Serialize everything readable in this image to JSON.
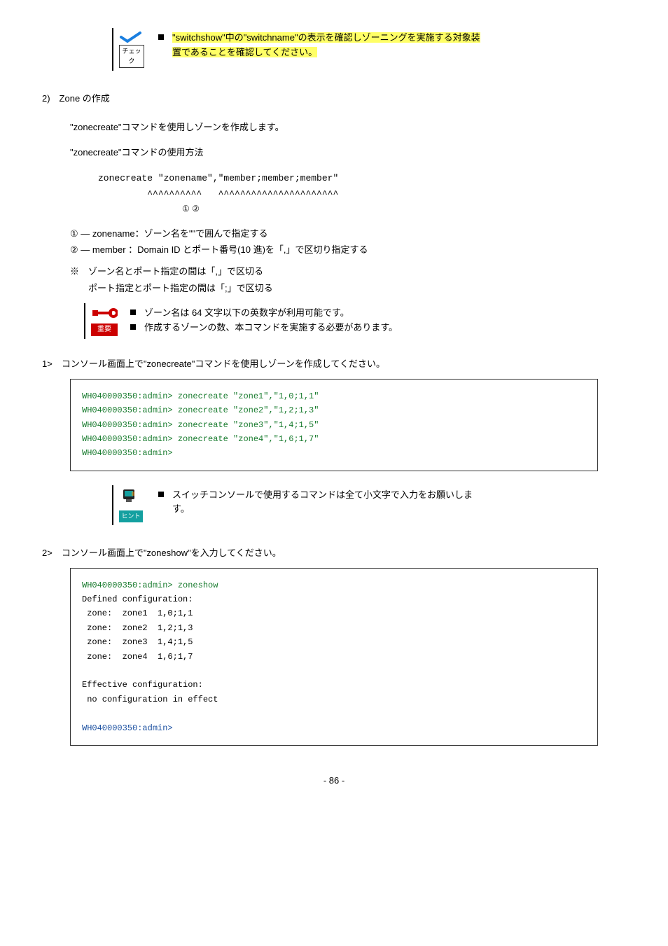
{
  "check": {
    "label": "チェック",
    "text_line1_a": "\"switchshow\"中の\"switchname\"の表示を確認しゾーニングを実施する対象装",
    "text_line2": "置であることを確認してください。"
  },
  "section": {
    "num_label": "2)　Zone の作成",
    "p1": "\"zonecreate\"コマンドを使用しゾーンを作成します。",
    "p2": "\"zonecreate\"コマンドの使用方法",
    "cmd": "zonecreate \"zonename\",\"member;member;member\"",
    "carets": "         ^^^^^^^^^^   ^^^^^^^^^^^^^^^^^^^^^^",
    "circled": "①                    ②",
    "def1": "① — zonename：ゾーン名を\"\"で囲んで指定する",
    "def2": "② — member  ：Domain ID とポート番号(10 進)を「,」で区切り指定する",
    "note1": "※　ゾーン名とポート指定の間は「,」で区切る",
    "note2": "　　ポート指定とポート指定の間は「;」で区切る"
  },
  "important": {
    "label": "重要",
    "b1": "ゾーン名は 64 文字以下の英数字が利用可能です。",
    "b2": "作成するゾーンの数、本コマンドを実施する必要があります。"
  },
  "step1": {
    "label": "1>　コンソール画面上で\"zonecreate\"コマンドを使用しゾーンを作成してください。",
    "code": "WH040000350:admin> zonecreate \"zone1\",\"1,0;1,1\"\nWH040000350:admin> zonecreate \"zone2\",\"1,2;1,3\"\nWH040000350:admin> zonecreate \"zone3\",\"1,4;1,5\"\nWH040000350:admin> zonecreate \"zone4\",\"1,6;1,7\"\nWH040000350:admin>"
  },
  "hint": {
    "label": "ヒント",
    "line1": "スイッチコンソールで使用するコマンドは全て小文字で入力をお願いしま",
    "line2": "す。"
  },
  "step2": {
    "label": "2>　コンソール画面上で\"zoneshow\"を入力してください。",
    "code_cmd": "WH040000350:admin> zoneshow",
    "code_body": "Defined configuration:\n zone:  zone1  1,0;1,1\n zone:  zone2  1,2;1,3\n zone:  zone3  1,4;1,5\n zone:  zone4  1,6;1,7\n\nEffective configuration:\n no configuration in effect\n",
    "code_prompt": "WH040000350:admin>"
  },
  "page_num": "- 86 -"
}
